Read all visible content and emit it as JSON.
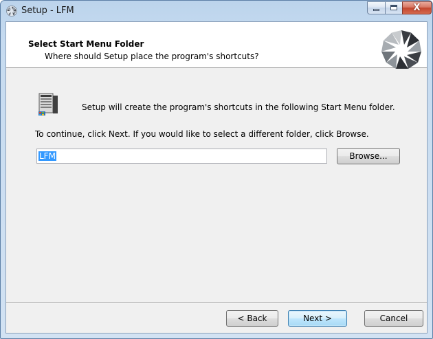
{
  "window": {
    "title": "Setup - LFM",
    "caption_buttons": {
      "minimize_icon": "minimize-icon",
      "maximize_icon": "maximize-icon",
      "close_icon": "close-icon",
      "close_glyph": "X"
    }
  },
  "header": {
    "title": "Select Start Menu Folder",
    "subtitle": "Where should Setup place the program's shortcuts?",
    "logo_icon": "setup-wizard-logo-icon"
  },
  "body": {
    "folder_icon": "start-menu-folder-icon",
    "info_text": "Setup will create the program's shortcuts in the following Start Menu folder.",
    "continue_text": "To continue, click Next. If you would like to select a different folder, click Browse.",
    "folder_input_value": "LFM",
    "browse_label": "Browse..."
  },
  "footer": {
    "back_label": "< Back",
    "next_label": "Next >",
    "cancel_label": "Cancel"
  },
  "colors": {
    "selection": "#3399ff",
    "titlebar": "#c6dbf0",
    "close_button": "#c3462e"
  }
}
